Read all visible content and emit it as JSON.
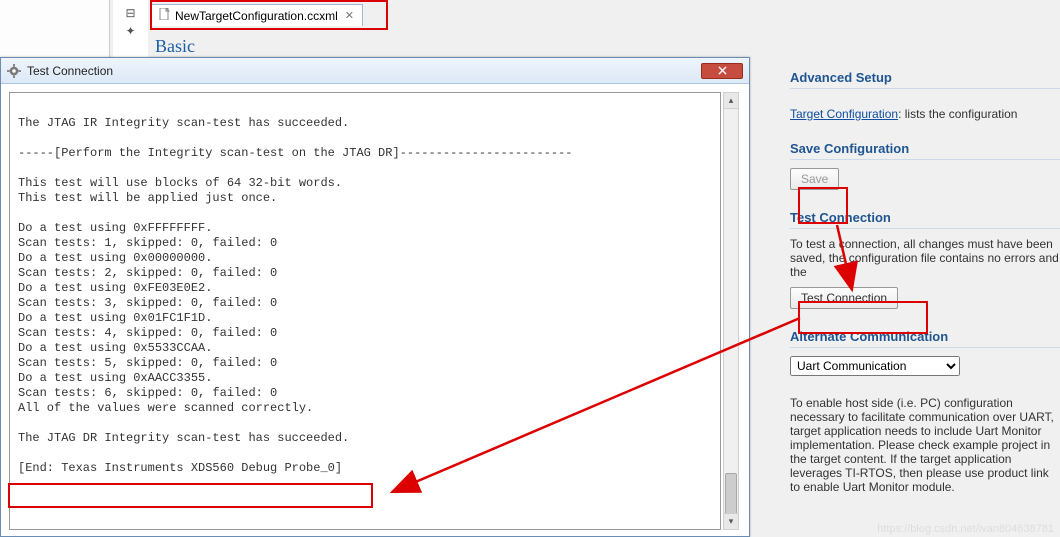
{
  "tab": {
    "filename": "NewTargetConfiguration.ccxml",
    "close_glyph": "✕"
  },
  "editor_header": "Basic",
  "dialog": {
    "title": "Test Connection",
    "console_text": "\nThe JTAG IR Integrity scan-test has succeeded.\n\n-----[Perform the Integrity scan-test on the JTAG DR]------------------------\n\nThis test will use blocks of 64 32-bit words.\nThis test will be applied just once.\n\nDo a test using 0xFFFFFFFF.\nScan tests: 1, skipped: 0, failed: 0\nDo a test using 0x00000000.\nScan tests: 2, skipped: 0, failed: 0\nDo a test using 0xFE03E0E2.\nScan tests: 3, skipped: 0, failed: 0\nDo a test using 0x01FC1F1D.\nScan tests: 4, skipped: 0, failed: 0\nDo a test using 0x5533CCAA.\nScan tests: 5, skipped: 0, failed: 0\nDo a test using 0xAACC3355.\nScan tests: 6, skipped: 0, failed: 0\nAll of the values were scanned correctly.\n\nThe JTAG DR Integrity scan-test has succeeded.\n\n[End: Texas Instruments XDS560 Debug Probe_0]\n"
  },
  "right": {
    "advanced_setup": {
      "heading": "Advanced Setup",
      "link_label": "Target Configuration",
      "link_suffix": ": lists the configuration"
    },
    "save": {
      "heading": "Save Configuration",
      "button_label": "Save"
    },
    "test": {
      "heading": "Test Connection",
      "desc": "To test a connection, all changes must have been saved, the configuration file contains no errors and the",
      "button_label": "Test Connection"
    },
    "altcomm": {
      "heading": "Alternate Communication",
      "selected": "Uart Communication",
      "desc": "To enable host side (i.e. PC) configuration necessary to facilitate communication over UART, target application needs to include Uart Monitor implementation. Please check example project in the target content. If the target application leverages TI-RTOS, then please use product link to enable Uart Monitor module."
    }
  },
  "watermark": "https://blog.csdn.net/ivan804638781"
}
